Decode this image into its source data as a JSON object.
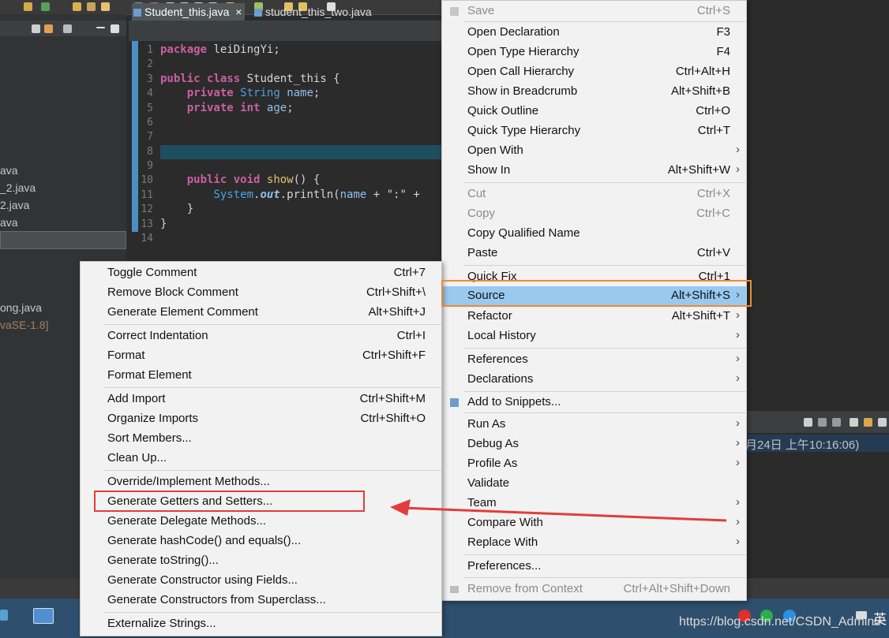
{
  "editor": {
    "tabs": [
      {
        "label": "Student_this.java",
        "close": "×"
      },
      {
        "label": "student_this_two.java"
      }
    ],
    "lines": [
      {
        "n": "1",
        "code": "package leiDingYi;"
      },
      {
        "n": "2",
        "code": ""
      },
      {
        "n": "3",
        "code": "public class Student_this {"
      },
      {
        "n": "4",
        "code": "    private String name;"
      },
      {
        "n": "5",
        "code": "    private int age;"
      },
      {
        "n": "6",
        "code": ""
      },
      {
        "n": "7",
        "code": ""
      },
      {
        "n": "8",
        "code": ""
      },
      {
        "n": "9",
        "code": ""
      },
      {
        "n": "10",
        "code": "    public void show() {"
      },
      {
        "n": "11",
        "code": "        System.out.println(name + \":\" +"
      },
      {
        "n": "12",
        "code": "    }"
      },
      {
        "n": "13",
        "code": "}"
      },
      {
        "n": "14",
        "code": ""
      }
    ]
  },
  "explorer": {
    "items": [
      "ava",
      "_2.java",
      "2.java",
      "ava",
      "ong.java",
      "vaSE-1.8]"
    ]
  },
  "context_menu": {
    "items": [
      {
        "label": "Save",
        "shortcut": "Ctrl+S",
        "disabled": true
      },
      {
        "label": "Open Declaration",
        "shortcut": "F3"
      },
      {
        "label": "Open Type Hierarchy",
        "shortcut": "F4"
      },
      {
        "label": "Open Call Hierarchy",
        "shortcut": "Ctrl+Alt+H"
      },
      {
        "label": "Show in Breadcrumb",
        "shortcut": "Alt+Shift+B"
      },
      {
        "label": "Quick Outline",
        "shortcut": "Ctrl+O"
      },
      {
        "label": "Quick Type Hierarchy",
        "shortcut": "Ctrl+T"
      },
      {
        "label": "Open With",
        "shortcut": "",
        "submenu": true
      },
      {
        "label": "Show In",
        "shortcut": "Alt+Shift+W",
        "submenu": true
      },
      {
        "label": "Cut",
        "shortcut": "Ctrl+X",
        "disabled": true
      },
      {
        "label": "Copy",
        "shortcut": "Ctrl+C",
        "disabled": true
      },
      {
        "label": "Copy Qualified Name",
        "shortcut": ""
      },
      {
        "label": "Paste",
        "shortcut": "Ctrl+V"
      },
      {
        "label": "Quick Fix",
        "shortcut": "Ctrl+1"
      },
      {
        "label": "Source",
        "shortcut": "Alt+Shift+S",
        "submenu": true,
        "selected": true
      },
      {
        "label": "Refactor",
        "shortcut": "Alt+Shift+T",
        "submenu": true
      },
      {
        "label": "Local History",
        "shortcut": "",
        "submenu": true
      },
      {
        "label": "References",
        "shortcut": "",
        "submenu": true
      },
      {
        "label": "Declarations",
        "shortcut": "",
        "submenu": true
      },
      {
        "label": "Add to Snippets...",
        "shortcut": ""
      },
      {
        "label": "Run As",
        "shortcut": "",
        "submenu": true
      },
      {
        "label": "Debug As",
        "shortcut": "",
        "submenu": true
      },
      {
        "label": "Profile As",
        "shortcut": "",
        "submenu": true
      },
      {
        "label": "Validate",
        "shortcut": ""
      },
      {
        "label": "Team",
        "shortcut": "",
        "submenu": true
      },
      {
        "label": "Compare With",
        "shortcut": "",
        "submenu": true
      },
      {
        "label": "Replace With",
        "shortcut": "",
        "submenu": true
      },
      {
        "label": "Preferences...",
        "shortcut": ""
      },
      {
        "label": "Remove from Context",
        "shortcut": "Ctrl+Alt+Shift+Down",
        "disabled": true
      }
    ]
  },
  "source_menu": {
    "items": [
      {
        "label": "Toggle Comment",
        "shortcut": "Ctrl+7"
      },
      {
        "label": "Remove Block Comment",
        "shortcut": "Ctrl+Shift+\\"
      },
      {
        "label": "Generate Element Comment",
        "shortcut": "Alt+Shift+J"
      },
      {
        "label": "Correct Indentation",
        "shortcut": "Ctrl+I"
      },
      {
        "label": "Format",
        "shortcut": "Ctrl+Shift+F"
      },
      {
        "label": "Format Element",
        "shortcut": ""
      },
      {
        "label": "Add Import",
        "shortcut": "Ctrl+Shift+M"
      },
      {
        "label": "Organize Imports",
        "shortcut": "Ctrl+Shift+O"
      },
      {
        "label": "Sort Members...",
        "shortcut": ""
      },
      {
        "label": "Clean Up...",
        "shortcut": ""
      },
      {
        "label": "Override/Implement Methods...",
        "shortcut": ""
      },
      {
        "label": "Generate Getters and Setters...",
        "shortcut": ""
      },
      {
        "label": "Generate Delegate Methods...",
        "shortcut": ""
      },
      {
        "label": "Generate hashCode() and equals()...",
        "shortcut": ""
      },
      {
        "label": "Generate toString()...",
        "shortcut": ""
      },
      {
        "label": "Generate Constructor using Fields...",
        "shortcut": ""
      },
      {
        "label": "Generate Constructors from Superclass...",
        "shortcut": ""
      },
      {
        "label": "Externalize Strings...",
        "shortcut": ""
      }
    ]
  },
  "console": {
    "text": "月24日 上午10:16:06)"
  },
  "watermark": "https://blog.csdn.net/CSDN_Admin0",
  "taskbar": {
    "ime": "英"
  },
  "colors": {
    "selection": "#99c9ef",
    "source_highlight": "#f08a2e",
    "getset_highlight": "#e23c3c",
    "arrow": "#e23c3c"
  }
}
